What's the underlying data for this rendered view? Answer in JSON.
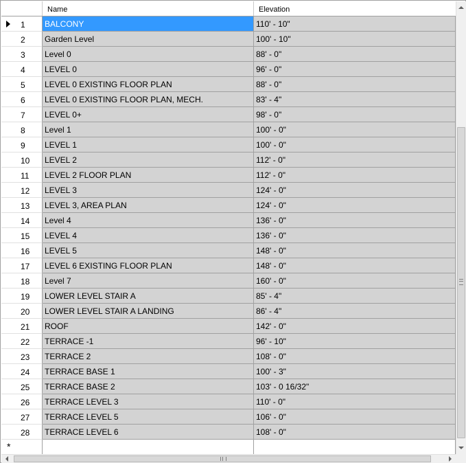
{
  "columns": {
    "name": "Name",
    "elevation": "Elevation"
  },
  "selected_row": 1,
  "rows": [
    {
      "num": "1",
      "name": "BALCONY",
      "elevation": "110' - 10\""
    },
    {
      "num": "2",
      "name": "Garden Level",
      "elevation": "100' - 10\""
    },
    {
      "num": "3",
      "name": "Level 0",
      "elevation": "88' - 0\""
    },
    {
      "num": "4",
      "name": "LEVEL 0",
      "elevation": "96' - 0\""
    },
    {
      "num": "5",
      "name": "LEVEL 0 EXISTING FLOOR PLAN",
      "elevation": "88' - 0\""
    },
    {
      "num": "6",
      "name": "LEVEL 0 EXISTING FLOOR PLAN, MECH.",
      "elevation": "83' - 4\""
    },
    {
      "num": "7",
      "name": "LEVEL 0+",
      "elevation": "98' - 0\""
    },
    {
      "num": "8",
      "name": "Level 1",
      "elevation": "100' - 0\""
    },
    {
      "num": "9",
      "name": "LEVEL 1",
      "elevation": "100' - 0\""
    },
    {
      "num": "10",
      "name": "LEVEL 2",
      "elevation": "112' - 0\""
    },
    {
      "num": "11",
      "name": "LEVEL 2 FLOOR PLAN",
      "elevation": "112' - 0\""
    },
    {
      "num": "12",
      "name": "LEVEL 3",
      "elevation": "124' - 0\""
    },
    {
      "num": "13",
      "name": "LEVEL 3, AREA PLAN",
      "elevation": "124' - 0\""
    },
    {
      "num": "14",
      "name": "Level 4",
      "elevation": "136' - 0\""
    },
    {
      "num": "15",
      "name": "LEVEL 4",
      "elevation": "136' - 0\""
    },
    {
      "num": "16",
      "name": "LEVEL 5",
      "elevation": "148' - 0\""
    },
    {
      "num": "17",
      "name": "LEVEL 6 EXISTING FLOOR PLAN",
      "elevation": "148' - 0\""
    },
    {
      "num": "18",
      "name": "Level 7",
      "elevation": "160' - 0\""
    },
    {
      "num": "19",
      "name": "LOWER LEVEL STAIR A",
      "elevation": "85' - 4\""
    },
    {
      "num": "20",
      "name": "LOWER LEVEL STAIR A LANDING",
      "elevation": "86' - 4\""
    },
    {
      "num": "21",
      "name": "ROOF",
      "elevation": "142' - 0\""
    },
    {
      "num": "22",
      "name": "TERRACE -1",
      "elevation": "96' - 10\""
    },
    {
      "num": "23",
      "name": "TERRACE 2",
      "elevation": "108' - 0\""
    },
    {
      "num": "24",
      "name": "TERRACE BASE 1",
      "elevation": "100' - 3\""
    },
    {
      "num": "25",
      "name": "TERRACE BASE 2",
      "elevation": "103' - 0 16/32\""
    },
    {
      "num": "26",
      "name": "TERRACE LEVEL 3",
      "elevation": "110' - 0\""
    },
    {
      "num": "27",
      "name": "TERRACE LEVEL 5",
      "elevation": "106' - 0\""
    },
    {
      "num": "28",
      "name": "TERRACE LEVEL 6",
      "elevation": "108' - 0\""
    }
  ],
  "new_row_marker": "*",
  "colors": {
    "selection": "#3399ff",
    "cell_bg": "#d3d3d3",
    "grid_line": "#a0a0a0"
  },
  "icons": {
    "row_indicator": "triangle-right-icon",
    "new_row": "asterisk-icon",
    "scroll_up": "arrow-up-icon",
    "scroll_down": "arrow-down-icon",
    "scroll_left": "arrow-left-icon",
    "scroll_right": "arrow-right-icon"
  }
}
